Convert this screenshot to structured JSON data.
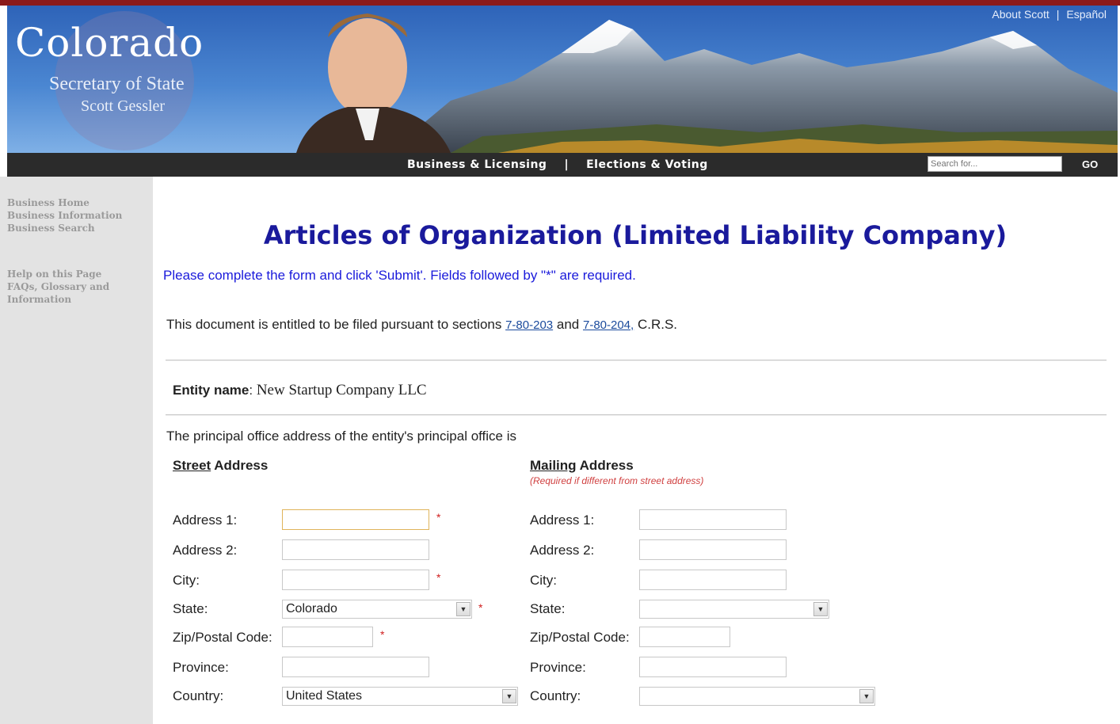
{
  "header": {
    "logo_title": "Colorado",
    "logo_subtitle": "Secretary of State",
    "logo_name": "Scott Gessler",
    "top_links": [
      "About Scott",
      "Español"
    ],
    "top_sep": "|"
  },
  "nav": {
    "links": [
      "Business & Licensing",
      "Elections & Voting"
    ],
    "sep": "|",
    "search_placeholder": "Search for...",
    "go_label": "GO"
  },
  "sidebar": {
    "group1": [
      "Business Home",
      "Business Information",
      "Business Search"
    ],
    "group2": [
      "Help on this Page",
      "FAQs, Glossary and Information"
    ]
  },
  "main": {
    "title": "Articles of Organization (Limited Liability Company)",
    "instructions": "Please complete the form and click 'Submit'. Fields followed by \"*\" are required.",
    "legal_prefix": "This document is entitled to be filed pursuant to sections",
    "legal_link1": "7-80-203",
    "legal_and": "and",
    "legal_link2": "7-80-204,",
    "legal_suffix": "C.R.S.",
    "entity_label": "Entity name",
    "entity_value": "New Startup Company LLC",
    "principal_text": "The principal office address of the entity's principal office is"
  },
  "street": {
    "heading_u": "Street",
    "heading_rest": " Address",
    "address1_label": "Address 1:",
    "address2_label": "Address 2:",
    "city_label": "City:",
    "state_label": "State:",
    "state_value": "Colorado",
    "zip_label": "Zip/Postal Code:",
    "province_label": "Province:",
    "country_label": "Country:",
    "country_value": "United States",
    "required_mark": "*"
  },
  "mailing": {
    "heading_u": "Mailing",
    "heading_rest": " Address",
    "note": "(Required if different from street address)",
    "address1_label": "Address 1:",
    "address2_label": "Address 2:",
    "city_label": "City:",
    "state_label": "State:",
    "zip_label": "Zip/Postal Code:",
    "province_label": "Province:",
    "country_label": "Country:"
  },
  "icons": {
    "dropdown": "chevron-down-icon"
  },
  "colors": {
    "title": "#1a1a9c",
    "instructions": "#1a1adb",
    "required": "#d02020",
    "nav_bg": "#2b2b2b"
  }
}
